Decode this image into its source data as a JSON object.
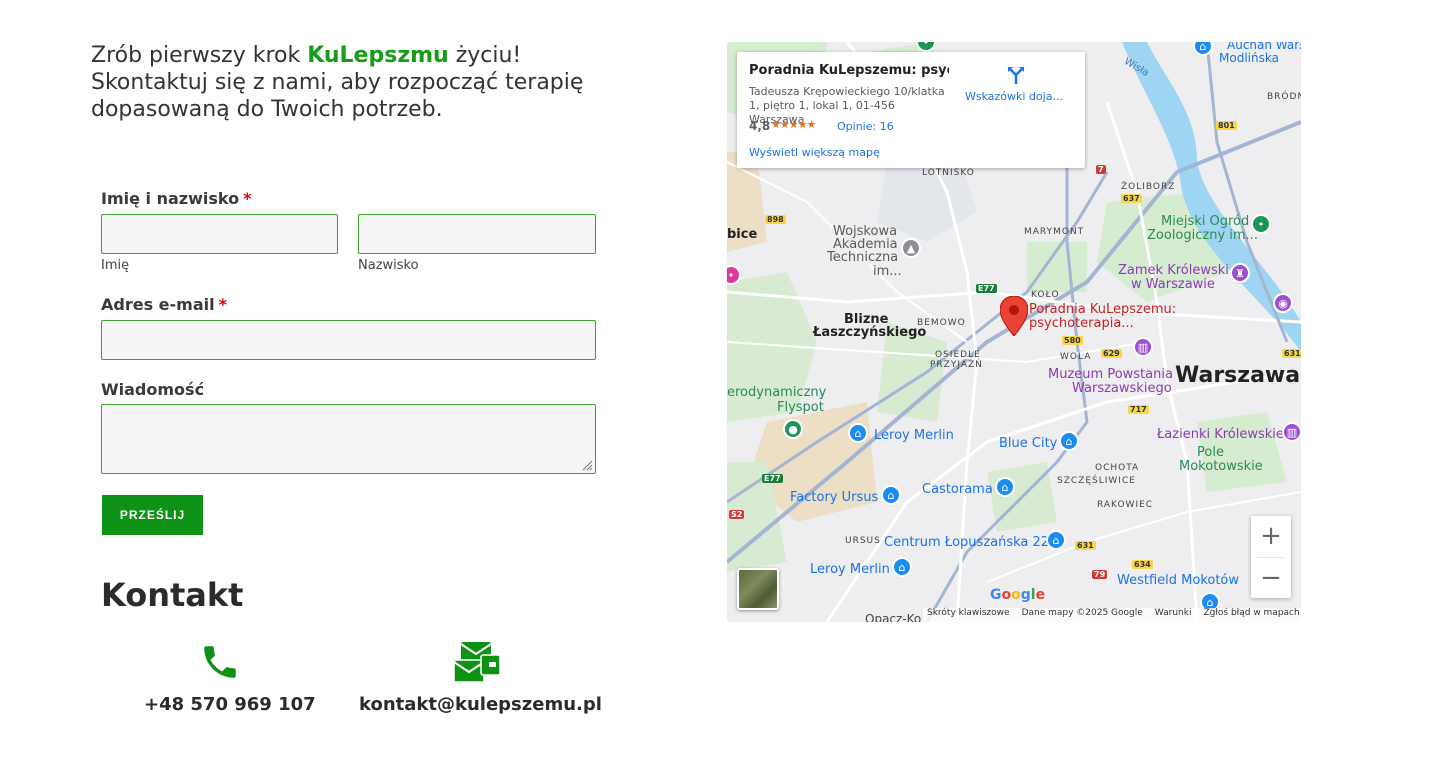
{
  "intro": {
    "line1_pre": "Zrób pierwszy krok ",
    "brand": "KuLepszmu",
    "line1_post": " życiu!",
    "line2": "Skontaktuj się z nami, aby rozpocząć terapię dopasowaną do Twoich potrzeb."
  },
  "form": {
    "name_label": "Imię i nazwisko",
    "required_mark": "*",
    "first_name_sub": "Imię",
    "last_name_sub": "Nazwisko",
    "email_label": "Adres e-mail",
    "message_label": "Wiadomość",
    "submit_label": "PRZEŚLIJ",
    "first_name_value": "",
    "last_name_value": "",
    "email_value": "",
    "message_value": ""
  },
  "contact": {
    "heading": "Kontakt",
    "phone": "+48 570 969 107",
    "email": "kontakt@kulepszemu.pl",
    "phone_icon": "phone-icon",
    "email_icon": "envelopes-icon"
  },
  "map": {
    "place_title": "Poradnia KuLepszemu: psych...",
    "address": "Tadeusza Krępowieckiego 10/klatka 1, piętro 1, lokal 1, 01-456 Warszawa",
    "rating": "4,8",
    "stars": "★★★★★",
    "reviews": "Opinie: 16",
    "directions": "Wskazówki doja...",
    "bigger_map": "Wyświetl większą mapę",
    "marker_label_1": "Poradnia KuLepszemu:",
    "marker_label_2": "psychoterapia...",
    "google": "Google",
    "attribution": [
      "Skróty klawiszowe",
      "Dane mapy ©2025 Google",
      "Warunki",
      "Zgłoś błąd w mapach"
    ],
    "zoom_in": "+",
    "zoom_out": "−",
    "labels": {
      "auchan1": "Auchan Wars",
      "auchan2": "Modlińska",
      "wisla": "Wisła",
      "brodno": "BRÓDNO",
      "lotnisko": "LOTNISKO",
      "zoliborz": "ŻOLIBORZ",
      "marymont": "MARYMONT",
      "wat1": "Wojskowa",
      "wat2": "Akademia",
      "wat3": "Techniczna",
      "wat4": "im...",
      "zoo1": "Miejski Ogród",
      "zoo2": "Zoologiczny im...",
      "zamek1": "Zamek Królewski",
      "zamek2": "w Warszawie",
      "kolo": "KOŁO",
      "blizne1": "Blizne",
      "blizne2": "Łaszczyńskiego",
      "bemowo": "BEMOWO",
      "osiedle1": "OSIEDLE",
      "osiedle2": "PRZYJAŹŃ",
      "wola": "WOLA",
      "muzeum1": "Muzeum Powstania",
      "muzeum2": "Warszawskiego",
      "warszawa": "Warszawa",
      "aero1": "erodynamiczny",
      "aero2": "Flyspot",
      "leroy1": "Leroy Merlin",
      "bluecity": "Blue City",
      "lazienki": "Łazienki Królewskie",
      "pole1": "Pole",
      "pole2": "Mokotowskie",
      "ochota": "OCHOTA",
      "szczesliwice": "SZCZĘŚLIWICE",
      "ursus_factory": "Factory Ursus",
      "castorama": "Castorama",
      "rakowiec": "RAKOWIEC",
      "ursus": "URSUS",
      "centrum": "Centrum Łopuszańska 22",
      "leroy2": "Leroy Merlin",
      "westfield": "Westfield Mokotów",
      "bice": "bice",
      "opacz": "Opacz-Ko"
    },
    "roads": {
      "r898": "898",
      "r801": "801",
      "r637": "637",
      "r7": "7",
      "e77a": "E77",
      "r580": "580",
      "r629": "629",
      "r631a": "631",
      "r717": "717",
      "e77b": "E77",
      "s2": "S2",
      "r631b": "631",
      "r634": "634",
      "r79": "79"
    }
  }
}
